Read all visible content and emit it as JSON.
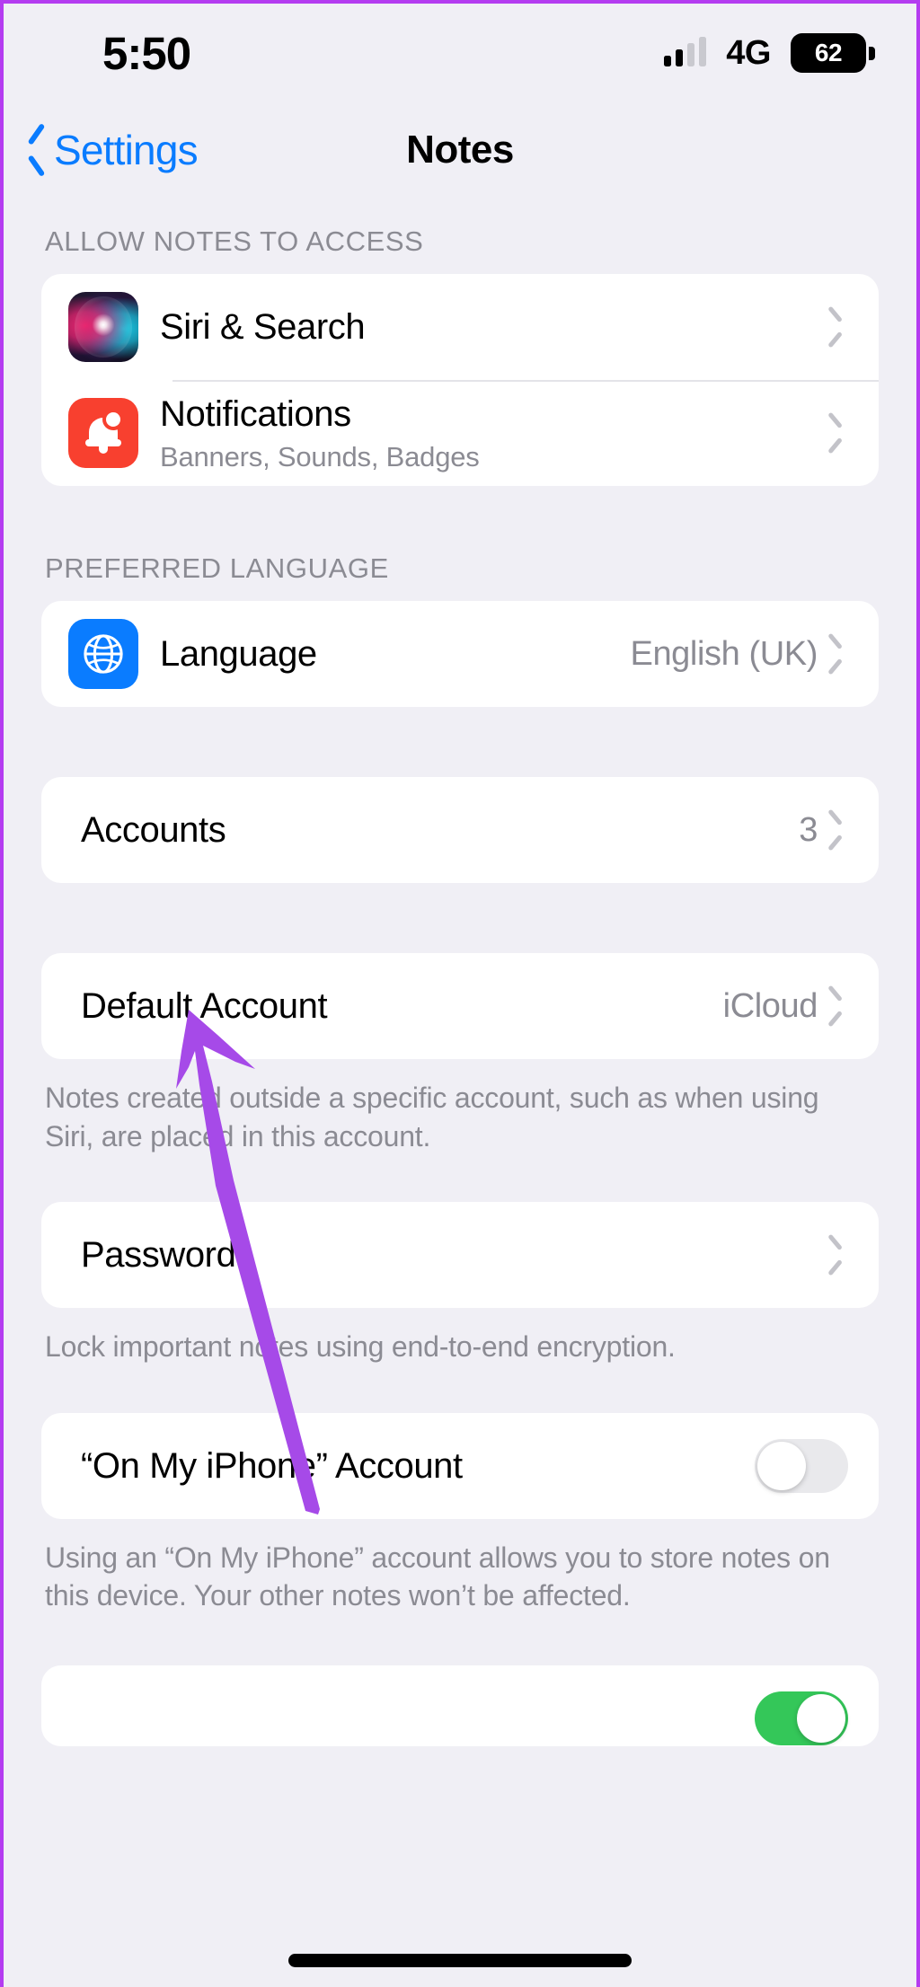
{
  "status_bar": {
    "time": "5:50",
    "network": "4G",
    "battery_level": "62",
    "signal_bars_filled": 2,
    "signal_bars_total": 4
  },
  "nav": {
    "back_label": "Settings",
    "title": "Notes",
    "back_icon": "chevron-left-icon",
    "accent_color": "#0a7cff"
  },
  "sections": {
    "access": {
      "header": "ALLOW NOTES TO ACCESS",
      "siri": {
        "title": "Siri & Search",
        "icon": "siri-icon"
      },
      "notifications": {
        "title": "Notifications",
        "subtitle": "Banners, Sounds, Badges",
        "icon": "notifications-bell-icon"
      }
    },
    "language": {
      "header": "PREFERRED LANGUAGE",
      "row": {
        "title": "Language",
        "value": "English (UK)",
        "icon": "globe-icon"
      }
    },
    "accounts": {
      "row": {
        "title": "Accounts",
        "value": "3"
      }
    },
    "default_account": {
      "row": {
        "title": "Default Account",
        "value": "iCloud"
      },
      "footer": "Notes created outside a specific account, such as when using Siri, are placed in this account."
    },
    "password": {
      "row": {
        "title": "Password"
      },
      "footer": "Lock important notes using end-to-end encryption."
    },
    "on_my_iphone": {
      "row": {
        "title": "“On My iPhone” Account",
        "toggle_state": "off"
      },
      "footer": "Using an “On My iPhone” account allows you to store notes on this device. Your other notes won’t be affected."
    },
    "bottom_partial": {
      "toggle_state": "on"
    }
  },
  "annotation": {
    "arrow_color": "#a64ae8",
    "points_at": "Accounts"
  },
  "colors": {
    "background": "#f0eff5",
    "card": "#ffffff",
    "secondary_text": "#8b8b93",
    "frame": "#b43cf0",
    "toggle_on": "#34c759",
    "notification_icon": "#f8402f",
    "language_icon": "#0a7cff"
  }
}
